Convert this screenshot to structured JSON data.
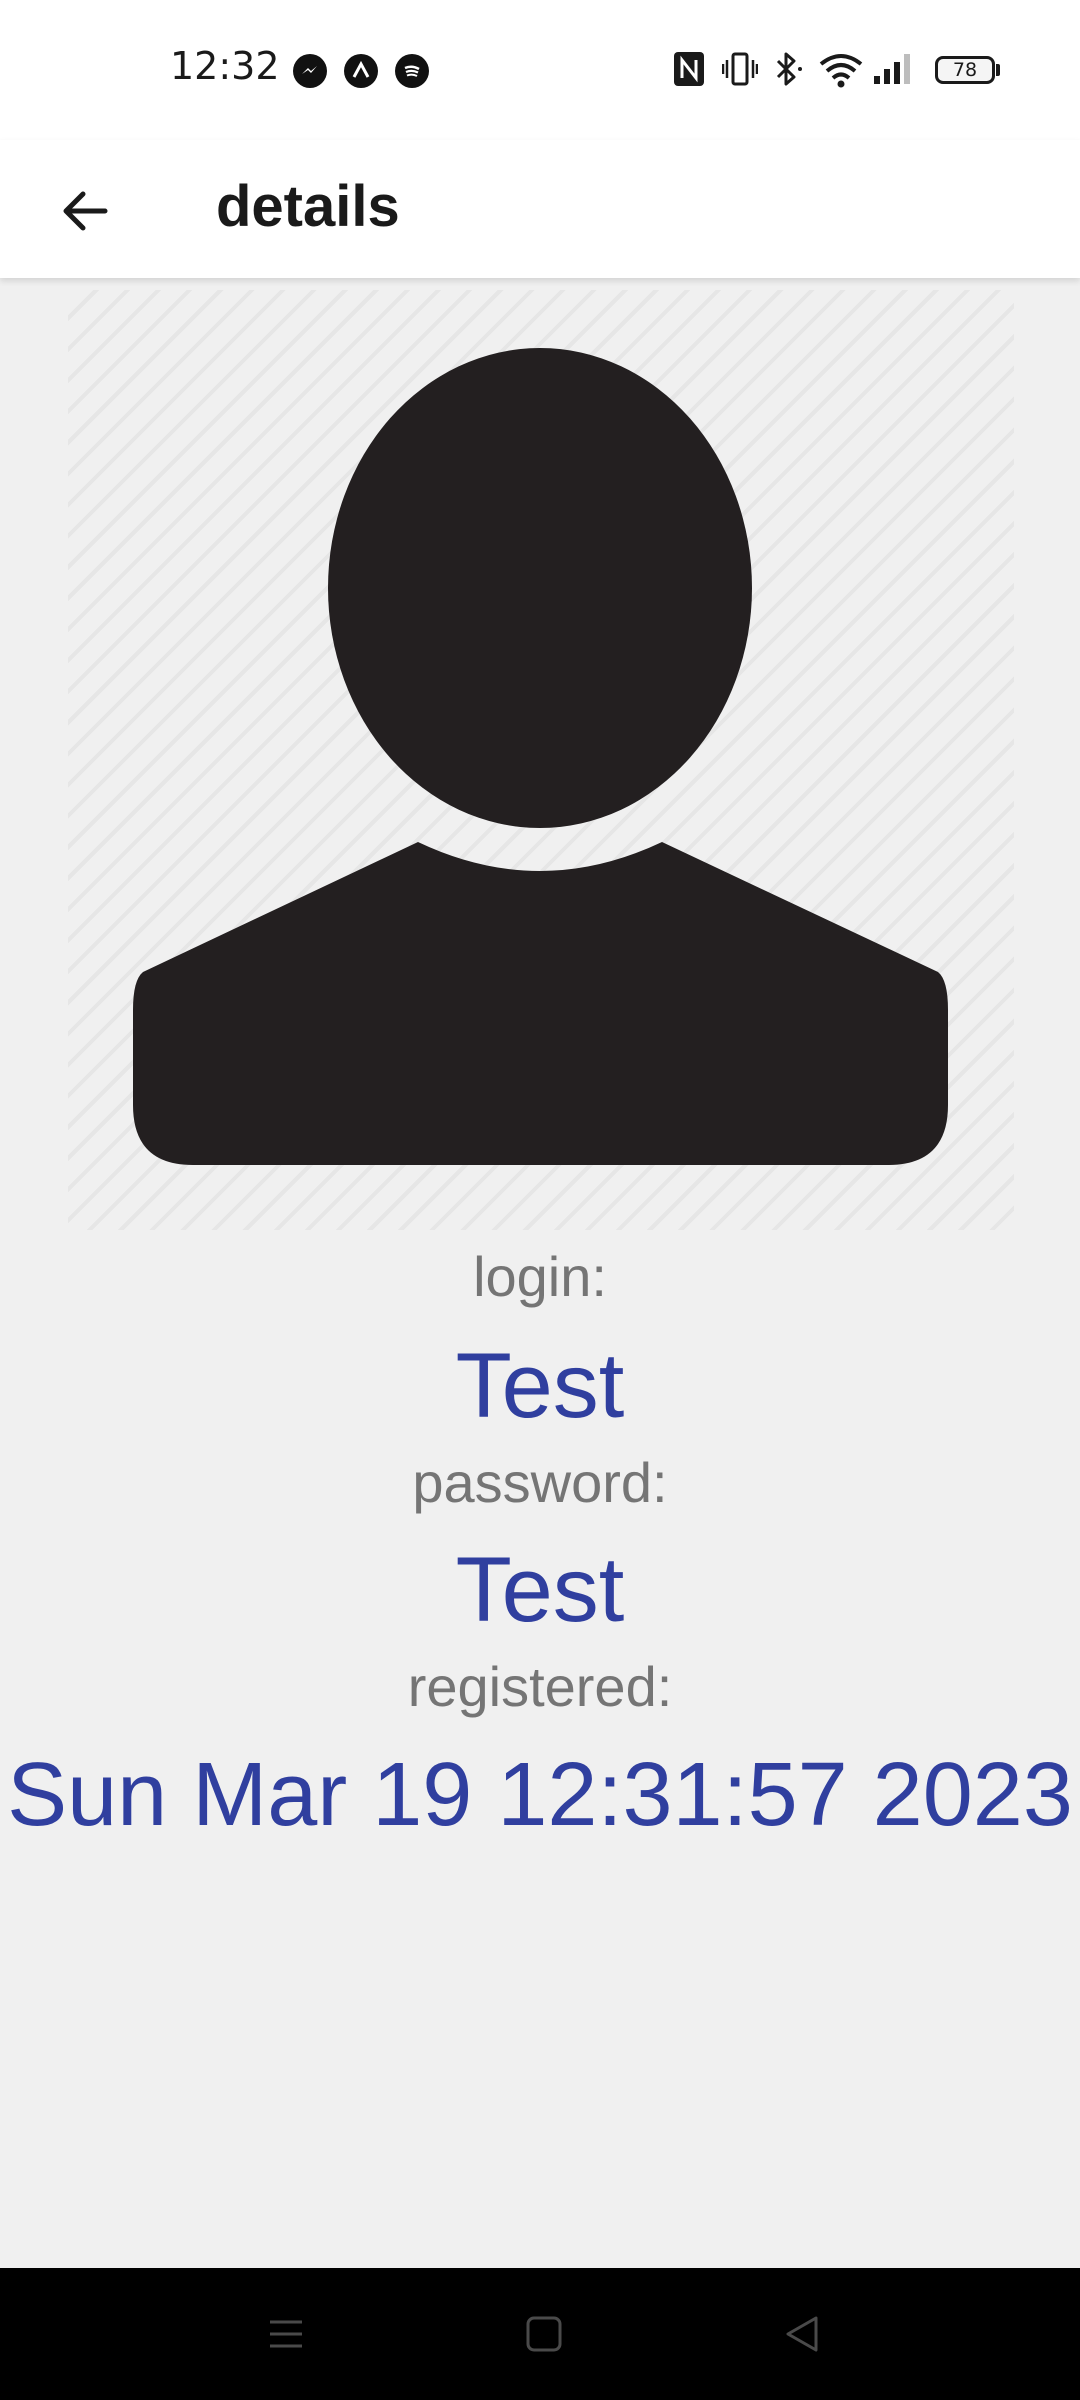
{
  "status_bar": {
    "time": "12:32",
    "battery": "78",
    "icons": [
      "messenger-icon",
      "arc-icon",
      "spotify-icon",
      "nfc-icon",
      "vibrate-icon",
      "bluetooth-icon",
      "wifi-icon",
      "signal-icon"
    ]
  },
  "app_bar": {
    "title": "details",
    "back_icon": "arrow-left-icon"
  },
  "avatar": {
    "icon": "person-placeholder-icon"
  },
  "details": {
    "login_label": "login:",
    "login_value": "Test",
    "password_label": "password:",
    "password_value": "Test",
    "registered_label": "registered:",
    "registered_value": "Sun Mar 19 12:31:57 2023"
  },
  "nav_bar": {
    "icons": [
      "menu-icon",
      "home-icon",
      "back-triangle-icon"
    ]
  },
  "colors": {
    "value_text": "#303f9f",
    "label_text": "#757575",
    "background": "#f0f0f0"
  }
}
